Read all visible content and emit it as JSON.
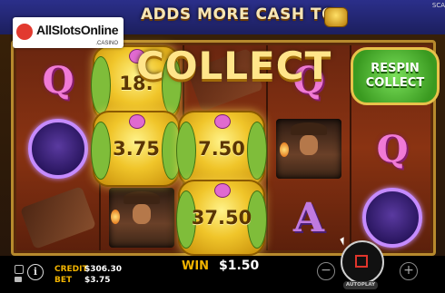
{
  "banner": {
    "text": "ADDS MORE CASH TO",
    "corner": "SCA"
  },
  "logo": {
    "name": "AllSlotsOnline",
    "sub": ".CASINO"
  },
  "reels": {
    "collect_text": "COLLECT",
    "respin_line1": "RESPIN",
    "respin_line2": "COLLECT",
    "scarab_values": [
      "18.",
      "3.75",
      "7.50",
      "37.50"
    ],
    "symbols": {
      "q": "Q",
      "a": "A"
    }
  },
  "bottom_bar": {
    "credit_label": "CREDIT",
    "credit_value": "$306.30",
    "bet_label": "BET",
    "bet_value": "$3.75",
    "win_label": "WIN",
    "win_value": "$1.50",
    "autoplay_label": "AUTOPLAY",
    "minus": "−",
    "plus": "+",
    "info": "i"
  },
  "colors": {
    "accent_gold": "#f2b400",
    "scarab_gold": "#f0c52a",
    "respin_green": "#3a9a20",
    "stop_red": "#e0352c"
  }
}
